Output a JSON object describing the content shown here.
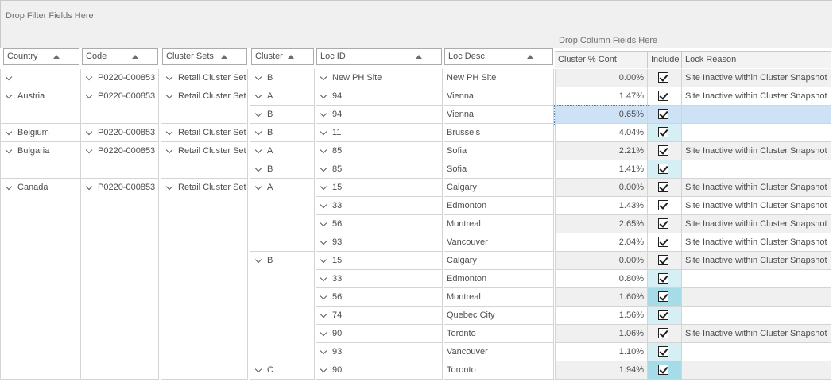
{
  "filter_zone": {
    "label": "Drop Filter Fields Here"
  },
  "column_zone": {
    "label": "Drop Column Fields Here"
  },
  "row_headers": [
    {
      "key": "country",
      "label": "Country"
    },
    {
      "key": "code",
      "label": "Code"
    },
    {
      "key": "cluster_sets",
      "label": "Cluster Sets"
    },
    {
      "key": "cluster",
      "label": "Cluster"
    },
    {
      "key": "loc_id",
      "label": "Loc ID"
    },
    {
      "key": "loc_desc",
      "label": "Loc Desc."
    }
  ],
  "data_headers": [
    {
      "key": "cluster_pct",
      "label": "Cluster % Cont"
    },
    {
      "key": "include",
      "label": "Include"
    },
    {
      "key": "lock_reason",
      "label": "Lock Reason"
    }
  ],
  "colors": {
    "header_bg": "#f0f0f0",
    "grid_line": "#d4d4d4",
    "selected_row": "#cde3f5",
    "include_cell_light": "#d6eff5",
    "include_cell_dark": "#a5dce8",
    "alt_row": "#f0f0f0"
  },
  "groups": [
    {
      "country": "",
      "code": "P0220-000853",
      "cluster_sets": "Retail Cluster Set",
      "rows": 1
    },
    {
      "country": "Austria",
      "code": "P0220-000853",
      "cluster_sets": "Retail Cluster Set",
      "rows": 2
    },
    {
      "country": "Belgium",
      "code": "P0220-000853",
      "cluster_sets": "Retail Cluster Set",
      "rows": 1
    },
    {
      "country": "Bulgaria",
      "code": "P0220-000853",
      "cluster_sets": "Retail Cluster Set",
      "rows": 2
    },
    {
      "country": "Canada",
      "code": "P0220-000853",
      "cluster_sets": "Retail Cluster Set",
      "rows": 11
    }
  ],
  "cluster_groups": [
    {
      "label": "B",
      "rows": 1
    },
    {
      "label": "A",
      "rows": 1
    },
    {
      "label": "B",
      "rows": 1
    },
    {
      "label": "B",
      "rows": 1
    },
    {
      "label": "A",
      "rows": 1
    },
    {
      "label": "B",
      "rows": 1
    },
    {
      "label": "A",
      "rows": 4
    },
    {
      "label": "B",
      "rows": 6
    },
    {
      "label": "C",
      "rows": 1
    }
  ],
  "rows": [
    {
      "loc_id": "New PH Site",
      "loc_desc": "New PH Site",
      "pct": "0.00%",
      "lock": "Site Inactive within Cluster Snapshot",
      "alt": true,
      "inc": "none",
      "selected": false
    },
    {
      "loc_id": "94",
      "loc_desc": "Vienna",
      "pct": "1.47%",
      "lock": "Site Inactive within Cluster Snapshot",
      "alt": false,
      "inc": "none",
      "selected": false
    },
    {
      "loc_id": "94",
      "loc_desc": "Vienna",
      "pct": "0.65%",
      "lock": "",
      "alt": false,
      "inc": "light",
      "selected": true
    },
    {
      "loc_id": "11",
      "loc_desc": "Brussels",
      "pct": "4.04%",
      "lock": "",
      "alt": false,
      "inc": "light",
      "selected": false
    },
    {
      "loc_id": "85",
      "loc_desc": "Sofia",
      "pct": "2.21%",
      "lock": "Site Inactive within Cluster Snapshot",
      "alt": true,
      "inc": "none",
      "selected": false
    },
    {
      "loc_id": "85",
      "loc_desc": "Sofia",
      "pct": "1.41%",
      "lock": "",
      "alt": false,
      "inc": "light",
      "selected": false
    },
    {
      "loc_id": "15",
      "loc_desc": "Calgary",
      "pct": "0.00%",
      "lock": "Site Inactive within Cluster Snapshot",
      "alt": true,
      "inc": "none",
      "selected": false
    },
    {
      "loc_id": "33",
      "loc_desc": "Edmonton",
      "pct": "1.43%",
      "lock": "Site Inactive within Cluster Snapshot",
      "alt": false,
      "inc": "none",
      "selected": false
    },
    {
      "loc_id": "56",
      "loc_desc": "Montreal",
      "pct": "2.65%",
      "lock": "Site Inactive within Cluster Snapshot",
      "alt": true,
      "inc": "none",
      "selected": false
    },
    {
      "loc_id": "93",
      "loc_desc": "Vancouver",
      "pct": "2.04%",
      "lock": "Site Inactive within Cluster Snapshot",
      "alt": false,
      "inc": "none",
      "selected": false
    },
    {
      "loc_id": "15",
      "loc_desc": "Calgary",
      "pct": "0.00%",
      "lock": "Site Inactive within Cluster Snapshot",
      "alt": true,
      "inc": "none",
      "selected": false
    },
    {
      "loc_id": "33",
      "loc_desc": "Edmonton",
      "pct": "0.80%",
      "lock": "",
      "alt": false,
      "inc": "light",
      "selected": false
    },
    {
      "loc_id": "56",
      "loc_desc": "Montreal",
      "pct": "1.60%",
      "lock": "",
      "alt": true,
      "inc": "dark",
      "selected": false
    },
    {
      "loc_id": "74",
      "loc_desc": "Quebec City",
      "pct": "1.56%",
      "lock": "",
      "alt": false,
      "inc": "light",
      "selected": false
    },
    {
      "loc_id": "90",
      "loc_desc": "Toronto",
      "pct": "1.06%",
      "lock": "Site Inactive within Cluster Snapshot",
      "alt": true,
      "inc": "none",
      "selected": false
    },
    {
      "loc_id": "93",
      "loc_desc": "Vancouver",
      "pct": "1.10%",
      "lock": "",
      "alt": false,
      "inc": "light",
      "selected": false
    },
    {
      "loc_id": "90",
      "loc_desc": "Toronto",
      "pct": "1.94%",
      "lock": "",
      "alt": true,
      "inc": "dark",
      "selected": false
    }
  ]
}
